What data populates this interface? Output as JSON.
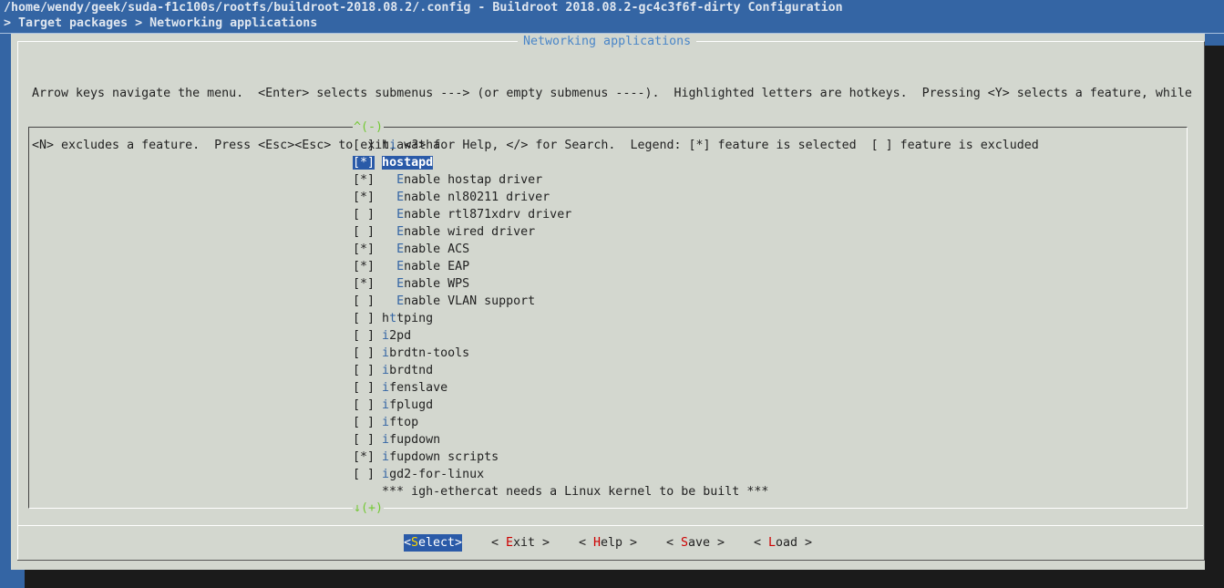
{
  "header": {
    "path_line": "/home/wendy/geek/suda-f1c100s/rootfs/buildroot-2018.08.2/.config - Buildroot 2018.08.2-gc4c3f6f-dirty Configuration",
    "breadcrumb": "> Target packages > Networking applications"
  },
  "dialog": {
    "title": "Networking applications",
    "help_line1": "Arrow keys navigate the menu.  <Enter> selects submenus ---> (or empty submenus ----).  Highlighted letters are hotkeys.  Pressing <Y> selects a feature, while",
    "help_line2": "<N> excludes a feature.  Press <Esc><Esc> to exit, <?> for Help, </> for Search.  Legend: [*] feature is selected  [ ] feature is excluded",
    "scroll_up": "^(-)",
    "scroll_down": "↓(+)"
  },
  "menu_items": [
    {
      "box": "[ ]",
      "indent": " ",
      "pre": "h",
      "hk": "i",
      "rest": "awatha",
      "selected": false
    },
    {
      "box": "[*]",
      "indent": " ",
      "pre": "",
      "hk": "h",
      "rest": "ostapd",
      "selected": true
    },
    {
      "box": "[*]",
      "indent": "   ",
      "pre": "",
      "hk": "E",
      "rest": "nable hostap driver",
      "selected": false
    },
    {
      "box": "[*]",
      "indent": "   ",
      "pre": "",
      "hk": "E",
      "rest": "nable nl80211 driver",
      "selected": false
    },
    {
      "box": "[ ]",
      "indent": "   ",
      "pre": "",
      "hk": "E",
      "rest": "nable rtl871xdrv driver",
      "selected": false
    },
    {
      "box": "[ ]",
      "indent": "   ",
      "pre": "",
      "hk": "E",
      "rest": "nable wired driver",
      "selected": false
    },
    {
      "box": "[*]",
      "indent": "   ",
      "pre": "",
      "hk": "E",
      "rest": "nable ACS",
      "selected": false
    },
    {
      "box": "[*]",
      "indent": "   ",
      "pre": "",
      "hk": "E",
      "rest": "nable EAP",
      "selected": false
    },
    {
      "box": "[*]",
      "indent": "   ",
      "pre": "",
      "hk": "E",
      "rest": "nable WPS",
      "selected": false
    },
    {
      "box": "[ ]",
      "indent": "   ",
      "pre": "",
      "hk": "E",
      "rest": "nable VLAN support",
      "selected": false
    },
    {
      "box": "[ ]",
      "indent": " ",
      "pre": "h",
      "hk": "t",
      "rest": "tping",
      "selected": false
    },
    {
      "box": "[ ]",
      "indent": " ",
      "pre": "",
      "hk": "i",
      "rest": "2pd",
      "selected": false
    },
    {
      "box": "[ ]",
      "indent": " ",
      "pre": "",
      "hk": "i",
      "rest": "brdtn-tools",
      "selected": false
    },
    {
      "box": "[ ]",
      "indent": " ",
      "pre": "",
      "hk": "i",
      "rest": "brdtnd",
      "selected": false
    },
    {
      "box": "[ ]",
      "indent": " ",
      "pre": "",
      "hk": "i",
      "rest": "fenslave",
      "selected": false
    },
    {
      "box": "[ ]",
      "indent": " ",
      "pre": "",
      "hk": "i",
      "rest": "fplugd",
      "selected": false
    },
    {
      "box": "[ ]",
      "indent": " ",
      "pre": "",
      "hk": "i",
      "rest": "ftop",
      "selected": false
    },
    {
      "box": "[ ]",
      "indent": " ",
      "pre": "",
      "hk": "i",
      "rest": "fupdown",
      "selected": false
    },
    {
      "box": "[*]",
      "indent": " ",
      "pre": "",
      "hk": "i",
      "rest": "fupdown scripts",
      "selected": false
    },
    {
      "box": "[ ]",
      "indent": " ",
      "pre": "",
      "hk": "i",
      "rest": "gd2-for-linux",
      "selected": false
    },
    {
      "box": "   ",
      "indent": " ",
      "pre": "",
      "hk": "",
      "rest": "*** igh-ethercat needs a Linux kernel to be built ***",
      "selected": false
    }
  ],
  "buttons": {
    "select": {
      "pre": "<",
      "hk": "S",
      "rest": "elect>"
    },
    "exit": {
      "pre": "< ",
      "hk": "E",
      "rest": "xit >"
    },
    "help": {
      "pre": "< ",
      "hk": "H",
      "rest": "elp >"
    },
    "save": {
      "pre": "< ",
      "hk": "S",
      "rest": "ave >"
    },
    "load": {
      "pre": "< ",
      "hk": "L",
      "rest": "oad >"
    }
  },
  "colors": {
    "background": "#3465a4",
    "dialog": "#d3d7cf",
    "highlight": "#2a5aa8",
    "hotkey_menu": "#3465a4",
    "hotkey_button": "#cc0000",
    "scroll_indicator": "#73c934"
  }
}
